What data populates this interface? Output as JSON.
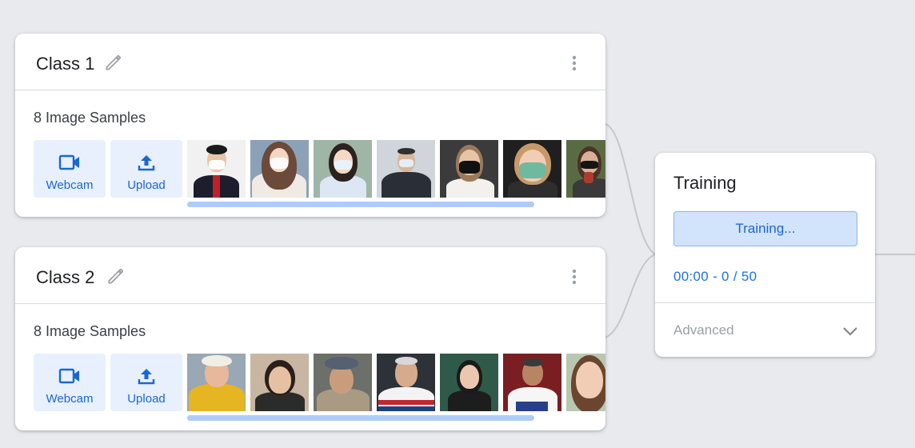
{
  "classes": [
    {
      "title": "Class 1",
      "samples_label": "8 Image Samples",
      "webcam_label": "Webcam",
      "upload_label": "Upload",
      "thumbnail_count": 7
    },
    {
      "title": "Class 2",
      "samples_label": "8 Image Samples",
      "webcam_label": "Webcam",
      "upload_label": "Upload",
      "thumbnail_count": 7
    }
  ],
  "training": {
    "title": "Training",
    "button_label": "Training...",
    "progress": "00:00 - 0 / 50",
    "advanced_label": "Advanced"
  },
  "colors": {
    "accent": "#1967d2",
    "button_bg": "#e8f0fe",
    "background": "#e8eaed"
  },
  "icons": [
    "pencil-icon",
    "more-vert-icon",
    "videocam-icon",
    "upload-icon",
    "chevron-down-icon"
  ]
}
